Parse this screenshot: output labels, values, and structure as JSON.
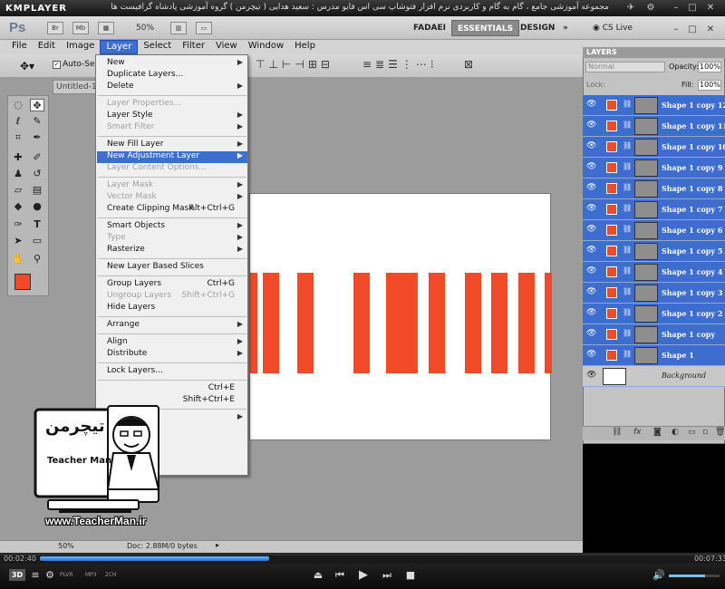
{
  "kmplayer": {
    "logo": "KMPLAYER",
    "caption": "مجموعه آموزشی جامع ، گام به گام و کاربردی نرم افزار فتوشاپ سی اس فایو مدرس : سعید هدایی ( تیچرمن ) گروه آموزشی پادشاه گرافیست ها",
    "current_time": "00:02:40",
    "total_time": "00:07:33",
    "progress_fraction": 0.32,
    "badges": [
      "3D",
      "PLVR",
      "MP3",
      "2CH"
    ]
  },
  "photoshop": {
    "app_logo": "Ps",
    "app_buttons": [
      "Br",
      "Mb"
    ],
    "zoom_top": "50%",
    "workspaces": [
      "FADAEI",
      "ESSENTIALS",
      "DESIGN"
    ],
    "cs_live": "CS Live",
    "menubar": [
      "File",
      "Edit",
      "Image",
      "Layer",
      "Select",
      "Filter",
      "View",
      "Window",
      "Help"
    ],
    "options_bar": {
      "auto_select": "Auto-Selec"
    },
    "doc_tab": "Untitled-1",
    "status": {
      "zoom": "50%",
      "doc": "Doc: 2.88M/0 bytes"
    },
    "accent": "#3d6fcf",
    "shape_color": "#f04a28"
  },
  "layer_menu": {
    "items": [
      {
        "label": "New",
        "arrow": true
      },
      {
        "label": "Duplicate Layers...",
        "arrow": false
      },
      {
        "label": "Delete",
        "arrow": true
      },
      {
        "sep": true
      },
      {
        "label": "Layer Properties...",
        "disabled": true
      },
      {
        "label": "Layer Style",
        "arrow": true
      },
      {
        "label": "Smart Filter",
        "disabled": true,
        "arrow": true
      },
      {
        "sep": true
      },
      {
        "label": "New Fill Layer",
        "arrow": true
      },
      {
        "label": "New Adjustment Layer",
        "arrow": true,
        "highlight": true
      },
      {
        "label": "Layer Content Options...",
        "disabled": true
      },
      {
        "sep": true
      },
      {
        "label": "Layer Mask",
        "disabled": true,
        "arrow": true
      },
      {
        "label": "Vector Mask",
        "disabled": true,
        "arrow": true
      },
      {
        "label": "Create Clipping Mask",
        "shortcut": "Alt+Ctrl+G"
      },
      {
        "sep": true
      },
      {
        "label": "Smart Objects",
        "arrow": true
      },
      {
        "label": "Type",
        "disabled": true,
        "arrow": true
      },
      {
        "label": "Rasterize",
        "arrow": true
      },
      {
        "sep": true
      },
      {
        "label": "New Layer Based Slices"
      },
      {
        "sep": true
      },
      {
        "label": "Group Layers",
        "shortcut": "Ctrl+G"
      },
      {
        "label": "Ungroup Layers",
        "disabled": true,
        "shortcut": "Shift+Ctrl+G"
      },
      {
        "label": "Hide Layers"
      },
      {
        "sep": true
      },
      {
        "label": "Arrange",
        "arrow": true
      },
      {
        "sep": true
      },
      {
        "label": "Align",
        "arrow": true
      },
      {
        "label": "Distribute",
        "arrow": true
      },
      {
        "sep": true
      },
      {
        "label": "Lock Layers..."
      },
      {
        "sep": true
      },
      {
        "label": "",
        "shortcut": "Ctrl+E"
      },
      {
        "label": "",
        "shortcut": "Shift+Ctrl+E"
      },
      {
        "sep": true
      },
      {
        "label": "",
        "arrow": true
      }
    ]
  },
  "layers_panel": {
    "title": "LAYERS",
    "blend_mode": "Normal",
    "opacity_label": "Opacity:",
    "opacity": "100%",
    "lock_label": "Lock:",
    "fill_label": "Fill:",
    "fill": "100%",
    "layers": [
      {
        "name": "Shape 1 copy 12",
        "selected": true
      },
      {
        "name": "Shape 1 copy 11",
        "selected": true
      },
      {
        "name": "Shape 1 copy 10",
        "selected": true
      },
      {
        "name": "Shape 1 copy 9",
        "selected": true
      },
      {
        "name": "Shape 1 copy 8",
        "selected": true
      },
      {
        "name": "Shape 1 copy 7",
        "selected": true
      },
      {
        "name": "Shape 1 copy 6",
        "selected": true
      },
      {
        "name": "Shape 1 copy 5",
        "selected": true
      },
      {
        "name": "Shape 1 copy 4",
        "selected": true
      },
      {
        "name": "Shape 1 copy 3",
        "selected": true
      },
      {
        "name": "Shape 1 copy 2",
        "selected": true
      },
      {
        "name": "Shape 1 copy",
        "selected": true
      },
      {
        "name": "Shape 1",
        "selected": true
      },
      {
        "name": "Background",
        "selected": false,
        "background": true
      }
    ]
  },
  "watermark": {
    "brand": "Teacher Man",
    "persian": "تیچرمن",
    "website": "www.TeacherMan.ir"
  }
}
